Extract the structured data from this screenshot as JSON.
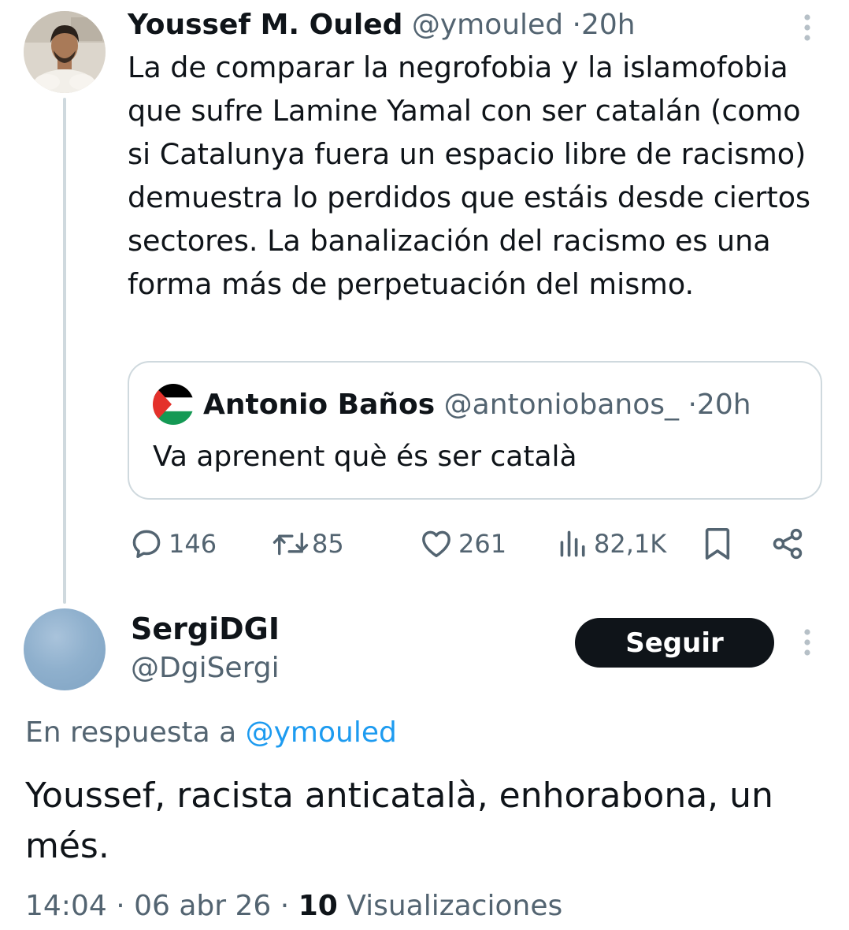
{
  "parent_tweet": {
    "author_name": "Youssef M. Ouled",
    "author_handle": "@ymouled",
    "separator": "·",
    "time": "20h",
    "text": "La de comparar la negrofobia y la islamofobia que sufre Lamine Yamal con ser catalán (como si Catalunya fuera un espacio libre de racismo) demuestra lo perdidos que estáis desde ciertos sectores. La banalización del racismo es una forma más de perpetuación del mismo.",
    "avatar_icon": "profile-photo-man"
  },
  "quote": {
    "author_name": "Antonio Baños",
    "author_handle": "@antoniobanos_",
    "separator": "·",
    "time": "20h",
    "text": "Va aprenent què és ser català",
    "avatar_icon": "palestine-flag-icon"
  },
  "actions": {
    "replies": "146",
    "reposts": "85",
    "likes": "261",
    "views": "82,1K"
  },
  "reply": {
    "author_name": "SergiDGI",
    "author_handle": "@DgiSergi",
    "follow_label": "Seguir",
    "in_reply_prefix": "En respuesta a",
    "in_reply_handle": "@ymouled",
    "text": "Youssef, racista anticatalà, enhorabona, un més.",
    "time": "14:04",
    "date": "06 abr 26",
    "separator": "·",
    "views_count": "10",
    "views_label": "Visualizaciones"
  },
  "colors": {
    "text_primary": "#0f1419",
    "text_secondary": "#536471",
    "link": "#1d9bf0",
    "border": "#cfd9de",
    "button_bg": "#0f1419"
  }
}
